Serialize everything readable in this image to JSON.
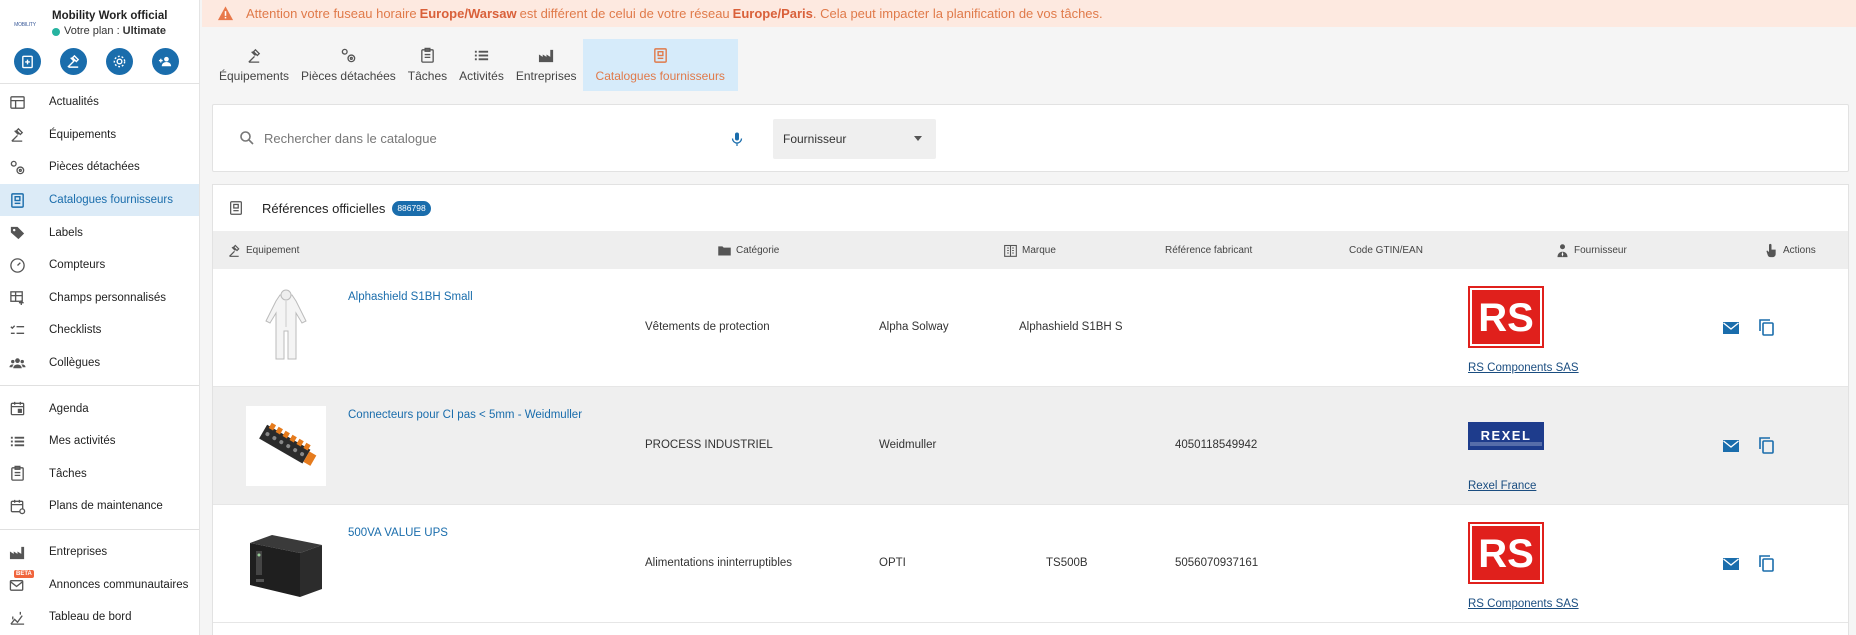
{
  "brand": {
    "logo_text": "MOBILITY",
    "name": "Mobility Work official",
    "plan_label": "Votre plan :",
    "plan_value": "Ultimate"
  },
  "quick_actions": [
    {
      "name": "add-task-quick-icon"
    },
    {
      "name": "add-equipment-quick-icon"
    },
    {
      "name": "add-part-quick-icon"
    },
    {
      "name": "add-user-quick-icon"
    }
  ],
  "sidebar": {
    "group1": [
      {
        "label": "Actualités",
        "icon": "news-icon"
      },
      {
        "label": "Équipements",
        "icon": "equipment-icon"
      },
      {
        "label": "Pièces détachées",
        "icon": "parts-icon"
      },
      {
        "label": "Catalogues fournisseurs",
        "icon": "catalog-icon",
        "active": true
      },
      {
        "label": "Labels",
        "icon": "label-icon"
      },
      {
        "label": "Compteurs",
        "icon": "counter-icon"
      },
      {
        "label": "Champs personnalisés",
        "icon": "custom-fields-icon"
      },
      {
        "label": "Checklists",
        "icon": "checklist-icon"
      },
      {
        "label": "Collègues",
        "icon": "colleagues-icon"
      }
    ],
    "group2": [
      {
        "label": "Agenda",
        "icon": "calendar-icon"
      },
      {
        "label": "Mes activités",
        "icon": "activities-list-icon"
      },
      {
        "label": "Tâches",
        "icon": "tasks-icon"
      },
      {
        "label": "Plans de maintenance",
        "icon": "maintenance-plan-icon"
      }
    ],
    "group3": [
      {
        "label": "Entreprises",
        "icon": "factory-icon"
      },
      {
        "label": "Annonces communautaires",
        "icon": "announcements-icon",
        "beta": "BETA"
      },
      {
        "label": "Tableau de bord",
        "icon": "dashboard-icon"
      }
    ]
  },
  "banner": {
    "prefix": "Attention votre fuseau horaire",
    "tz_local": "Europe/Warsaw",
    "middle": "est différent de celui de votre réseau",
    "tz_network": "Europe/Paris",
    "suffix": ". Cela peut impacter la planification de vos tâches."
  },
  "tabs": [
    {
      "label": "Équipements",
      "icon": "equipment-icon"
    },
    {
      "label": "Pièces détachées",
      "icon": "parts-icon"
    },
    {
      "label": "Tâches",
      "icon": "tasks-icon"
    },
    {
      "label": "Activités",
      "icon": "activities-list-icon"
    },
    {
      "label": "Entreprises",
      "icon": "factory-icon"
    },
    {
      "label": "Catalogues fournisseurs",
      "icon": "catalog-icon",
      "active": true
    }
  ],
  "search": {
    "placeholder": "Rechercher dans le catalogue",
    "supplier_select": "Fournisseur"
  },
  "references": {
    "title": "Références officielles",
    "count": "886798"
  },
  "columns": {
    "equipment": "Equipement",
    "category": "Catégorie",
    "brand": "Marque",
    "manufacturer_ref": "Référence fabricant",
    "gtin": "Code GTIN/EAN",
    "supplier": "Fournisseur",
    "actions": "Actions"
  },
  "rows": [
    {
      "name": "Alphashield S1BH Small",
      "category": "Vêtements de protection",
      "brand": "Alpha Solway",
      "ref": "Alphashield S1BH S",
      "gtin": "",
      "supplier": "RS Components SAS",
      "supplier_logo": "RS"
    },
    {
      "name": "Connecteurs pour CI pas < 5mm - Weidmuller",
      "category": "PROCESS INDUSTRIEL",
      "brand": "Weidmuller",
      "ref": "",
      "gtin": "4050118549942",
      "supplier": "Rexel France",
      "supplier_logo": "REXEL"
    },
    {
      "name": "500VA VALUE UPS",
      "category": "Alimentations ininterruptibles",
      "brand": "OPTI",
      "ref": "TS500B",
      "gtin": "5056070937161",
      "supplier": "RS Components SAS",
      "supplier_logo": "RS"
    }
  ],
  "colors": {
    "primary": "#1a6dac",
    "accent": "#e07a4a",
    "banner_bg": "#fde9e0",
    "active_bg": "#dcebf7"
  }
}
